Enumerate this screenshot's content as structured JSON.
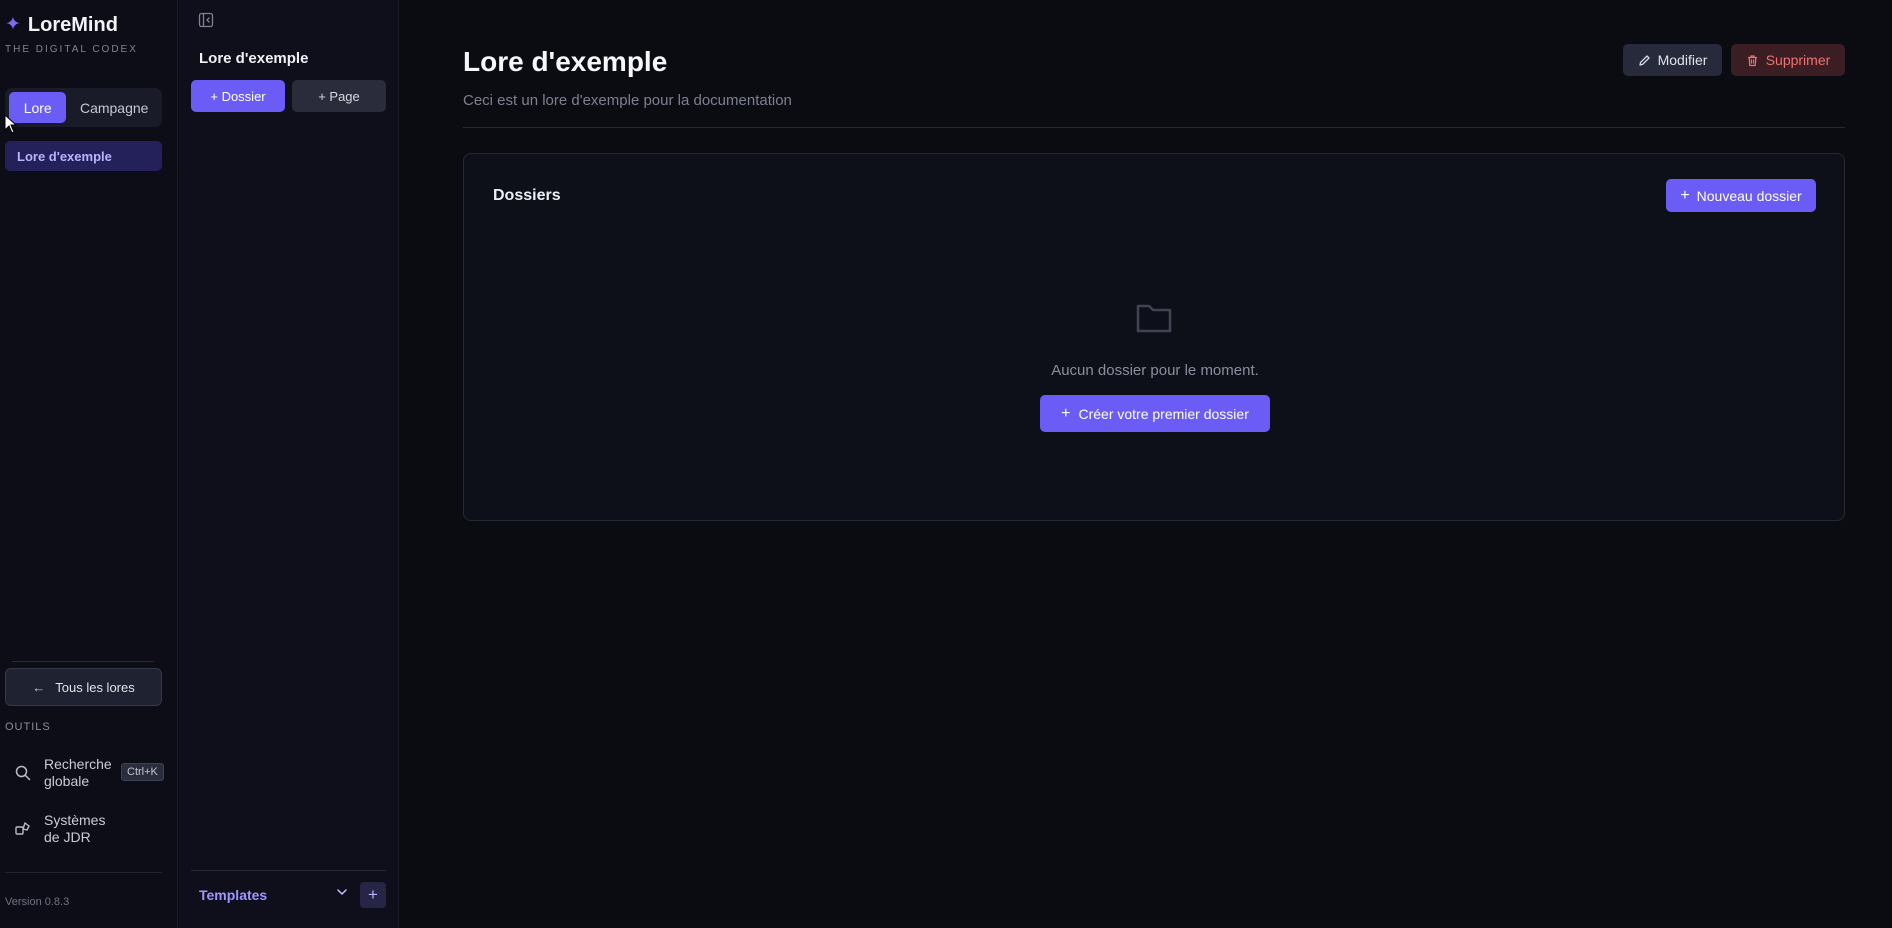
{
  "brand": {
    "name": "LoreMind",
    "subtitle": "THE DIGITAL CODEX"
  },
  "nav": {
    "modes": [
      "Lore",
      "Campagne"
    ],
    "active_mode": "Lore",
    "lore_item": "Lore d'exemple",
    "back_button": "Tous les lores",
    "tools_label": "OUTILS",
    "tools": [
      {
        "label": "Recherche globale",
        "shortcut": "Ctrl+K",
        "icon": "search-icon"
      },
      {
        "label": "Systèmes de JDR",
        "icon": "dice-shapes-icon"
      }
    ],
    "version": "Version 0.8.3"
  },
  "tree": {
    "title": "Lore d'exemple",
    "add_folder": "+ Dossier",
    "add_page": "+ Page",
    "templates_label": "Templates"
  },
  "main": {
    "title": "Lore d'exemple",
    "description": "Ceci est un lore d'exemple pour la documentation",
    "edit_button": "Modifier",
    "delete_button": "Supprimer",
    "card": {
      "title": "Dossiers",
      "new_folder_button": "Nouveau dossier",
      "empty_text": "Aucun dossier pour le moment.",
      "create_first_button": "Créer votre premier dossier"
    }
  },
  "colors": {
    "accent": "#6b5cf5",
    "background": "#0b0b12",
    "danger": "#f0716d"
  }
}
